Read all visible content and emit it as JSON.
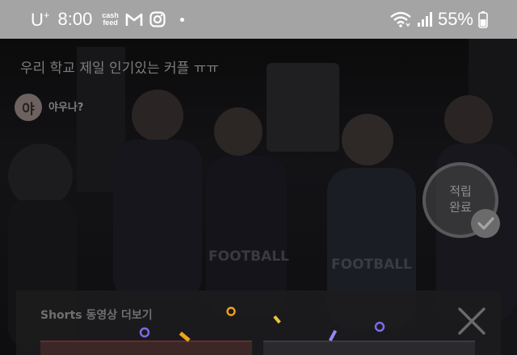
{
  "status_bar": {
    "carrier": "U",
    "carrier_sup": "+",
    "time": "8:00",
    "cashfeed_line1": "cash",
    "cashfeed_line2": "feed",
    "battery": "55%",
    "icons": [
      "gmail-icon",
      "instagram-icon",
      "notification-dot",
      "wifi-icon",
      "signal-icon",
      "battery-icon"
    ]
  },
  "video": {
    "title": "우리 학교 제일 인기있는 커플 ㅠㅠ",
    "channel_avatar": "야",
    "channel_name": "야우나?",
    "scene_lettering": [
      "FOOTBALL",
      "FOOTBALL"
    ]
  },
  "reward": {
    "label": "적립\n완료"
  },
  "shorts": {
    "label": "Shorts 동영상 더보기"
  },
  "colors": {
    "status_bar": "#a4a4a4",
    "confetti_purple": "#7c6cf0",
    "confetti_orange": "#f0a21e",
    "confetti_yellow": "#e9c63a",
    "thumb_red": "#5c2f33"
  }
}
